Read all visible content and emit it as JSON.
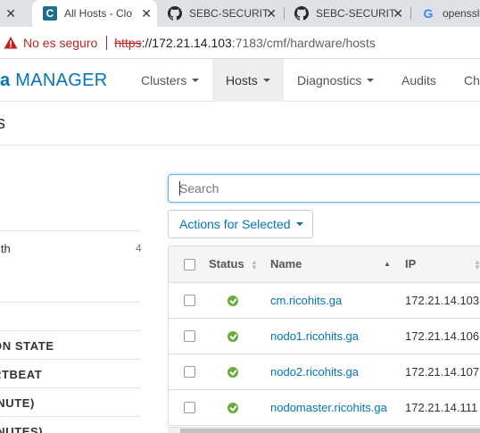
{
  "browser": {
    "tabs": [
      {
        "label": "",
        "close": "✕"
      },
      {
        "label": "All Hosts - Clo",
        "close": "✕"
      },
      {
        "label": "SEBC-SECURIT",
        "close": "✕"
      },
      {
        "label": "SEBC-SECURIT",
        "close": "✕"
      },
      {
        "label": "openssl",
        "close": ""
      }
    ],
    "security_label": "No es seguro",
    "url_scheme": "https",
    "url_host": "://172.21.14.103",
    "url_path": ":7183/cmf/hardware/hosts"
  },
  "navbar": {
    "brand_suffix": "a",
    "brand_main": " MANAGER",
    "items": [
      {
        "label": "Clusters"
      },
      {
        "label": "Hosts"
      },
      {
        "label": "Diagnostics"
      },
      {
        "label": "Audits"
      },
      {
        "label": "Ch"
      }
    ]
  },
  "page": {
    "title": "s"
  },
  "filters": {
    "health_label": "lth",
    "health_count": "4",
    "sections": [
      "ON STATE",
      "RTBEAT",
      "INUTE)",
      "INUTES)"
    ]
  },
  "search": {
    "placeholder": "Search"
  },
  "actions": {
    "label": "Actions for Selected"
  },
  "table": {
    "headers": {
      "status": "Status",
      "name": "Name",
      "ip": "IP"
    },
    "rows": [
      {
        "name": "cm.ricohits.ga",
        "ip": "172.21.14.103"
      },
      {
        "name": "nodo1.ricohits.ga",
        "ip": "172.21.14.106"
      },
      {
        "name": "nodo2.ricohits.ga",
        "ip": "172.21.14.107"
      },
      {
        "name": "nodomaster.ricohits.ga",
        "ip": "172.21.14.111"
      }
    ]
  },
  "colors": {
    "brand": "#0075bc",
    "good_status": "#6aad3b",
    "insecure": "#c5221f"
  }
}
